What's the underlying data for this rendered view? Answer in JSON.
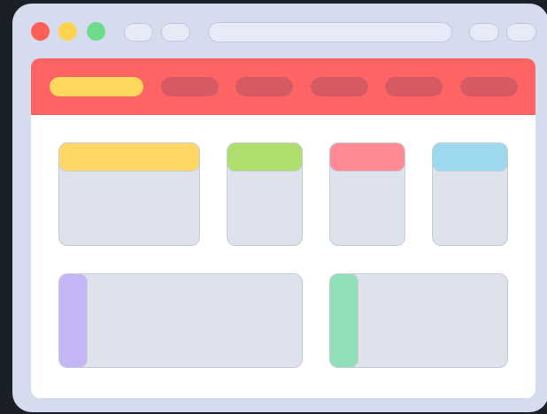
{
  "colors": {
    "background": "#1b1f26",
    "window_frame": "#d4dcee",
    "titlebar_pill": "#e6ebf7",
    "close_dot": "#ff5f57",
    "minimize_dot": "#ffd24f",
    "maximize_dot": "#6fdc8c",
    "navbar": "#ff6464",
    "nav_active": "#ffd95e",
    "nav_inactive": "#d65a64",
    "content_bg": "#ffffff",
    "card_body": "#dee2ec",
    "card_yellow": "#ffd764",
    "card_green": "#aedf6e",
    "card_pink": "#ff8a95",
    "card_blue": "#9cd8ee",
    "card_purple": "#c4b5f5",
    "card_mint": "#8fe0b7"
  },
  "icons": {
    "close": "close-dot-icon",
    "minimize": "minimize-dot-icon",
    "maximize": "maximize-dot-icon"
  },
  "navbar": {
    "items": [
      {
        "state": "active"
      },
      {
        "state": "inactive"
      },
      {
        "state": "inactive"
      },
      {
        "state": "inactive"
      },
      {
        "state": "inactive"
      },
      {
        "state": "inactive"
      }
    ]
  },
  "cards_top": [
    {
      "accent": "yellow"
    },
    {
      "accent": "green"
    },
    {
      "accent": "pink"
    },
    {
      "accent": "blue"
    }
  ],
  "cards_bottom": [
    {
      "accent": "purple"
    },
    {
      "accent": "mint"
    }
  ]
}
